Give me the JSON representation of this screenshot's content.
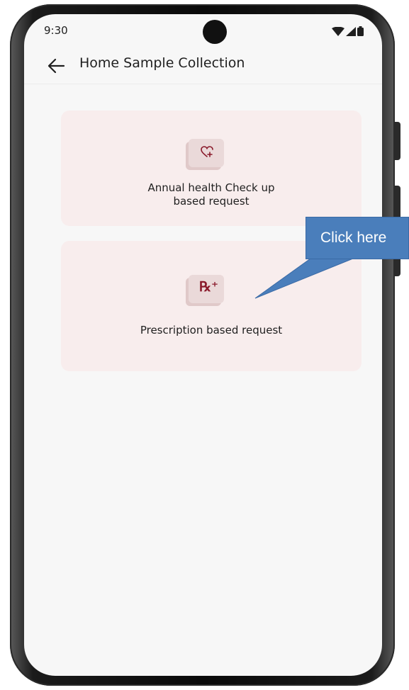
{
  "status_bar": {
    "time": "9:30"
  },
  "app_bar": {
    "title": "Home Sample Collection"
  },
  "options": [
    {
      "label": "Annual health Check up based request",
      "icon": "heart-plus-icon"
    },
    {
      "label": "Prescription based request",
      "icon": "rx-icon",
      "glyph": "℞⁺"
    }
  ],
  "callout": {
    "text": "Click here"
  },
  "colors": {
    "screen_bg": "#f7f7f7",
    "card_bg": "#f8eded",
    "icon_bg": "#ead9d9",
    "accent": "#8a1a2b",
    "callout_bg": "#4a7ebb"
  }
}
